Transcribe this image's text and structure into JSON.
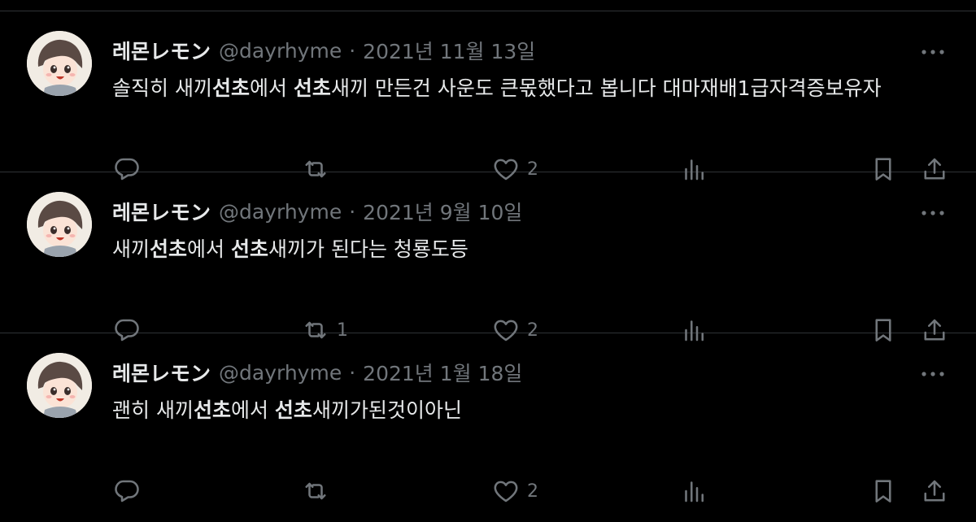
{
  "tweets": [
    {
      "name": "레몬レモン",
      "handle": "@dayrhyme",
      "separator": "·",
      "date": "2021년 11월 13일",
      "text_parts": [
        {
          "t": "솔직히 새끼",
          "b": false
        },
        {
          "t": "선초",
          "b": true
        },
        {
          "t": "에서 ",
          "b": false
        },
        {
          "t": "선초",
          "b": true
        },
        {
          "t": "새끼 만든건 사운도 큰몫했다고 봅니다 대마재배1급자격증보유자",
          "b": false
        }
      ],
      "reply_count": "",
      "retweet_count": "",
      "like_count": "2"
    },
    {
      "name": "레몬レモン",
      "handle": "@dayrhyme",
      "separator": "·",
      "date": "2021년 9월 10일",
      "text_parts": [
        {
          "t": "새끼",
          "b": false
        },
        {
          "t": "선초",
          "b": true
        },
        {
          "t": "에서 ",
          "b": false
        },
        {
          "t": "선초",
          "b": true
        },
        {
          "t": "새끼가 된다는 청룡도등",
          "b": false
        }
      ],
      "reply_count": "",
      "retweet_count": "1",
      "like_count": "2"
    },
    {
      "name": "레몬レモン",
      "handle": "@dayrhyme",
      "separator": "·",
      "date": "2021년 1월 18일",
      "text_parts": [
        {
          "t": "괜히 새끼",
          "b": false
        },
        {
          "t": "선초",
          "b": true
        },
        {
          "t": "에서 ",
          "b": false
        },
        {
          "t": "선초",
          "b": true
        },
        {
          "t": "새끼가된것이아닌",
          "b": false
        }
      ],
      "reply_count": "",
      "retweet_count": "",
      "like_count": "2"
    }
  ],
  "icons": {
    "more": "more-horizontal-icon",
    "reply": "reply-icon",
    "retweet": "retweet-icon",
    "like": "heart-icon",
    "views": "views-icon",
    "bookmark": "bookmark-icon",
    "share": "share-icon"
  },
  "colors": {
    "background": "#000000",
    "primary_text": "#e7e9ea",
    "secondary_text": "#71767b",
    "divider": "#2f3336"
  }
}
